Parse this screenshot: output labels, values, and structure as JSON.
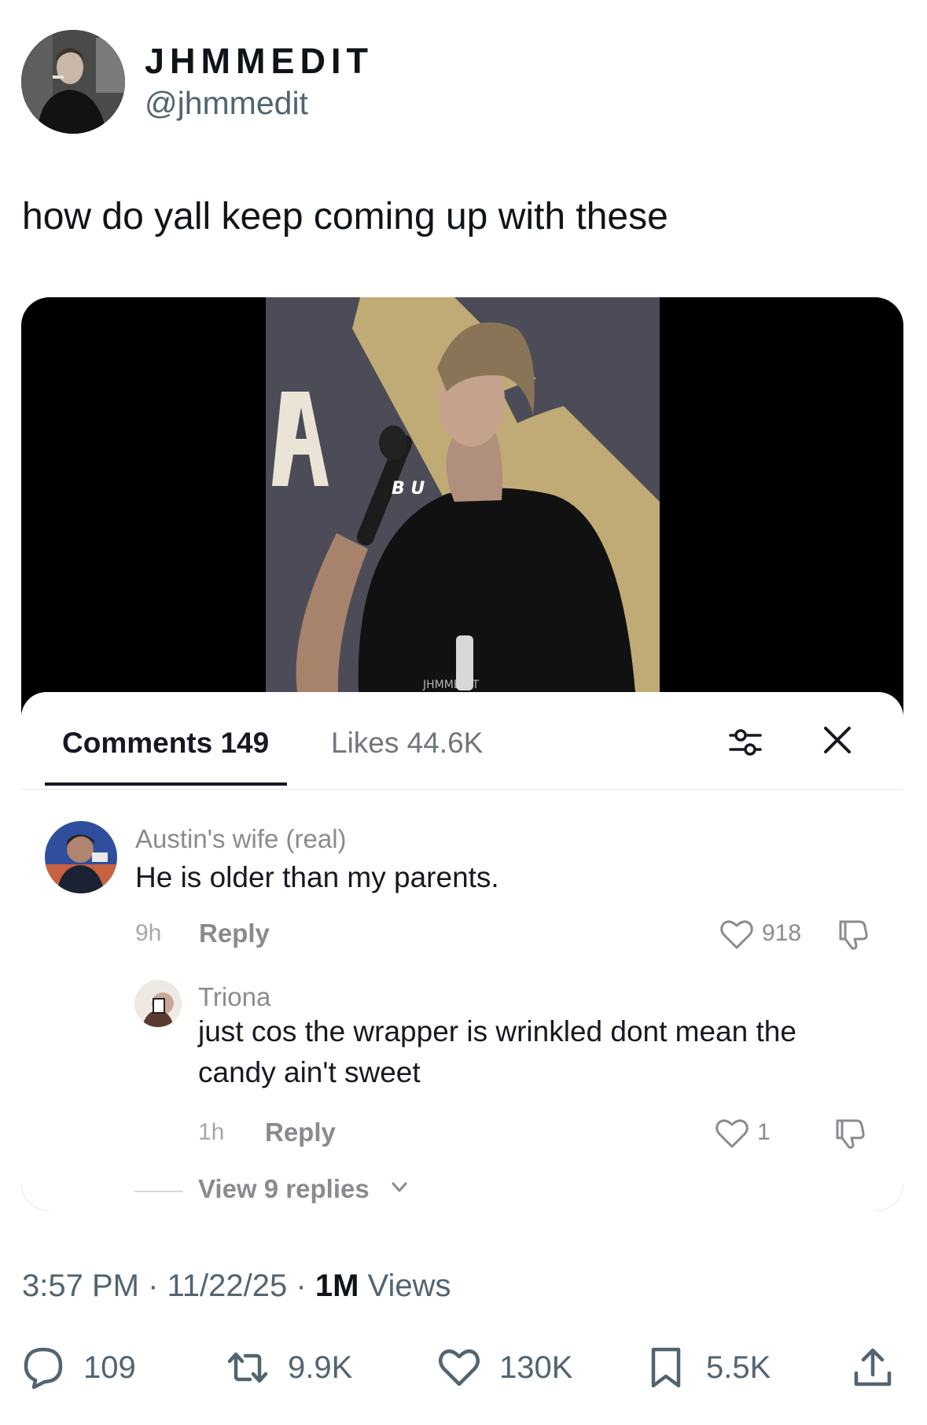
{
  "author": {
    "display_name": "JHMMEDIT",
    "handle": "@jhmmedit"
  },
  "tweet": {
    "text": "how do yall keep coming up with these"
  },
  "video_overlay": {
    "tabs": {
      "comments": "Comments 149",
      "likes": "Likes 44.6K"
    },
    "comments": [
      {
        "author": "Austin's wife (real)",
        "text": "He is older than my parents.",
        "time": "9h",
        "reply_label": "Reply",
        "likes": "918"
      },
      {
        "author": "Triona",
        "text": "just cos the wrapper is wrinkled dont mean the candy ain't sweet",
        "time": "1h",
        "reply_label": "Reply",
        "likes": "1"
      }
    ],
    "view_replies": "View 9 replies"
  },
  "meta": {
    "time": "3:57 PM",
    "date": "11/22/25",
    "views_count": "1M",
    "views_label": "Views"
  },
  "actions": {
    "replies": "109",
    "reposts": "9.9K",
    "likes": "130K",
    "bookmarks": "5.5K"
  },
  "icons": [
    "comment-icon",
    "repost-icon",
    "heart-icon",
    "bookmark-icon",
    "share-icon",
    "filter-icon",
    "close-icon",
    "dislike-icon",
    "chevron-down-icon"
  ],
  "colors": {
    "text_primary": "#0f1419",
    "text_secondary": "#536471",
    "tiktok_text": "#161823",
    "tiktok_muted": "#8a8b91"
  }
}
